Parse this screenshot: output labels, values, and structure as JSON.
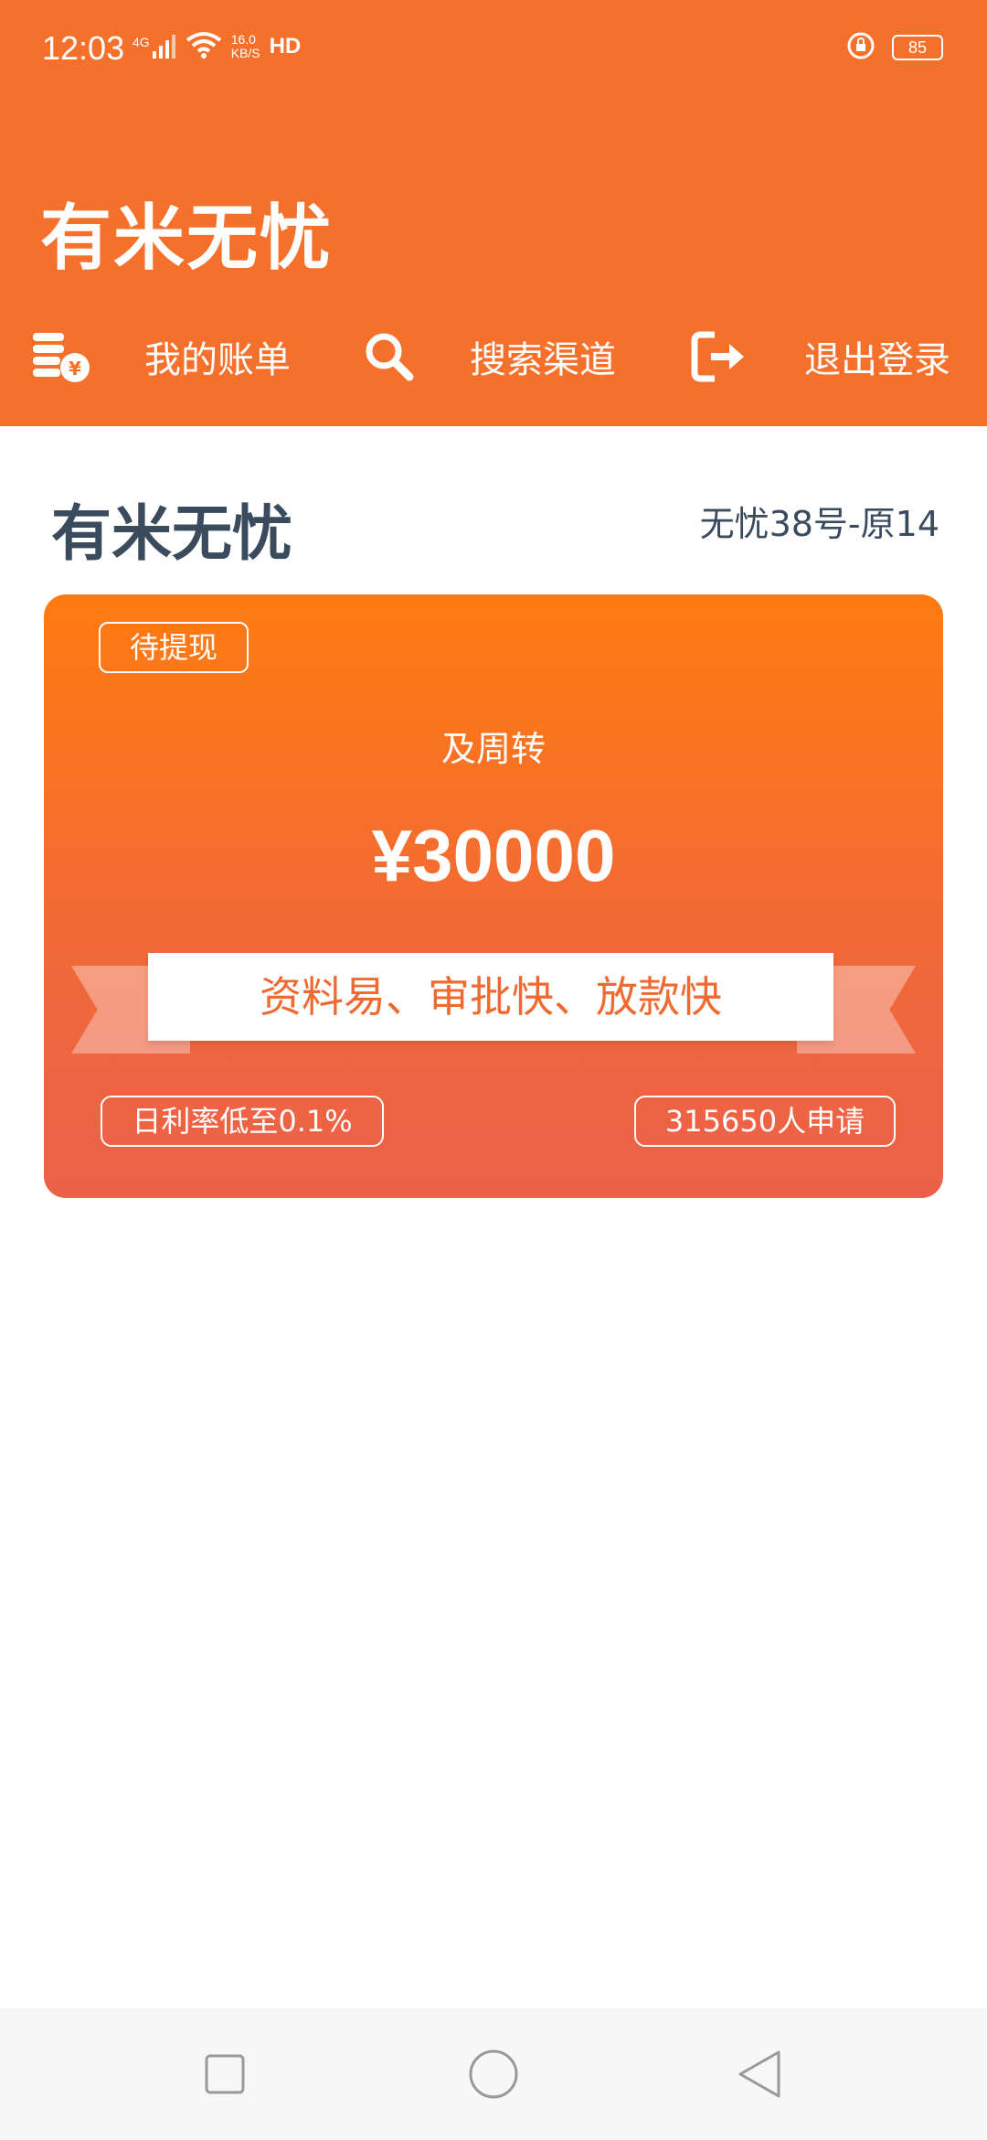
{
  "status_bar": {
    "time": "12:03",
    "network": "4G",
    "speed_value": "16.0",
    "speed_unit": "KB/S",
    "hd": "HD",
    "battery": "85"
  },
  "app": {
    "title": "有米无忧"
  },
  "toolbar": {
    "bill_label": "我的账单",
    "search_label": "搜索渠道",
    "logout_label": "退出登录"
  },
  "section": {
    "title": "有米无忧",
    "subtitle": "无忧38号-原14"
  },
  "card": {
    "badge": "待提现",
    "subtitle": "及周转",
    "amount": "¥30000",
    "ribbon": "资料易、审批快、放款快",
    "rate_tag": "日利率低至0.1%",
    "applicants_tag": "315650人申请"
  },
  "colors": {
    "primary": "#f5712b",
    "title_text": "#3b4b5e",
    "ribbon_text": "#ef6a31"
  }
}
